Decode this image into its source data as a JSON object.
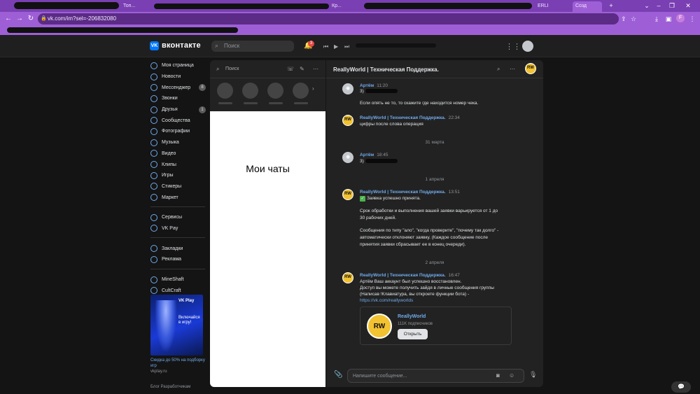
{
  "browser": {
    "tabs": [
      "Топ...",
      "Кр...",
      "ERLI",
      "Созд"
    ],
    "url": "vk.com/im?sel=-206832080",
    "profile_letter": "F"
  },
  "vk": {
    "logo_text": "вконтакте",
    "search_placeholder": "Поиск",
    "notification_count": "3"
  },
  "sidebar": {
    "items": [
      {
        "label": "Моя страница",
        "badge": ""
      },
      {
        "label": "Новости",
        "badge": ""
      },
      {
        "label": "Мессенджер",
        "badge": "8"
      },
      {
        "label": "Звонки",
        "badge": ""
      },
      {
        "label": "Друзья",
        "badge": "1"
      },
      {
        "label": "Сообщества",
        "badge": ""
      },
      {
        "label": "Фотографии",
        "badge": ""
      },
      {
        "label": "Музыка",
        "badge": ""
      },
      {
        "label": "Видео",
        "badge": ""
      },
      {
        "label": "Клипы",
        "badge": ""
      },
      {
        "label": "Игры",
        "badge": ""
      },
      {
        "label": "Стикеры",
        "badge": ""
      },
      {
        "label": "Маркет",
        "badge": ""
      }
    ],
    "group2": [
      "Сервисы",
      "VK Pay"
    ],
    "group3": [
      "Закладки",
      "Реклама"
    ],
    "group4": [
      "MineShaft",
      "CultCraft"
    ],
    "ad": {
      "brand": "VK Play",
      "text": "Включайся в игру!",
      "caption": "Скидка до 50% на подборку игр",
      "site": "vkplay.ru"
    },
    "footer": "Блог   Разработчикам"
  },
  "chatlist": {
    "search_placeholder": "Поиск",
    "placeholder_text": "Мои чаты"
  },
  "conversation": {
    "title": "ReallyWorld | Техническая Поддержка.",
    "messages": [
      {
        "author": "Артём",
        "time": "11:20",
        "lines": [
          "3)",
          "Если опять не то, то скажите где находится номер чека."
        ]
      },
      {
        "author": "ReallyWorld | Техническая Поддержка.",
        "time": "22:34",
        "lines": [
          "цифры после слова операция"
        ]
      },
      {
        "author": "Артём",
        "time": "18:45",
        "lines": [
          "3)"
        ]
      },
      {
        "author": "ReallyWorld | Техническая Поддержка.",
        "time": "13:51",
        "lines": [
          "Заявка успешно принята.",
          "Срок обработки и выполнения вашей заявки варьируется от 1 до",
          "30 рабочих дней.",
          "Сообщения по типу \"ало\", \"когда проверите\", \"почему так долго\" -",
          "автоматически отклоняют заявку. (Каждое сообщение после",
          "принятия заявки сбрасывает ее в конец очереди)."
        ]
      },
      {
        "author": "ReallyWorld | Техническая Поддержка.",
        "time": "16:47",
        "lines": [
          "Артём Ваш аккаунт был успешно восстановлен.",
          "Доступ вы можете получить зайдя в личные сообщения группы",
          "(Написав !Клавиатура, вы откроете функции бота) -",
          "https://vk.com/reallyworlds"
        ]
      }
    ],
    "dates": [
      "31 марта",
      "1 апреля",
      "2 апреля"
    ],
    "card": {
      "name": "ReallyWorld",
      "subscribers": "111K подписчиков",
      "button": "Открыть"
    },
    "composer_placeholder": "Напишите сообщение..."
  },
  "colors": {
    "accent": "#71aaeb",
    "browser_purple": "#9e5fd6",
    "vk_blue": "#0077ff",
    "success": "#4bb34b"
  }
}
